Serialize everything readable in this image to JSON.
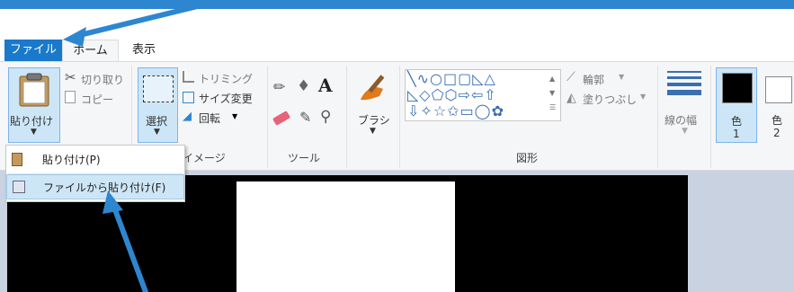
{
  "tabs": [
    {
      "label": "ファイル"
    },
    {
      "label": "ホーム"
    },
    {
      "label": "表示"
    }
  ],
  "clipboard": {
    "paste_label": "貼り付け",
    "cut_label": "切り取り",
    "copy_label": "コピー"
  },
  "image": {
    "select_label": "選択",
    "crop_label": "トリミング",
    "resize_label": "サイズ変更",
    "rotate_label": "回転",
    "group_label": "イメージ"
  },
  "tools": {
    "group_label": "ツール",
    "text_tool_label": "A"
  },
  "brush": {
    "label": "ブラシ"
  },
  "shapes": {
    "outline_label": "輪郭",
    "fill_label": "塗りつぶし",
    "group_label": "図形"
  },
  "size": {
    "label": "線の幅"
  },
  "colors": {
    "color1_label": "色",
    "color1_num": "1",
    "color2_label": "色",
    "color2_num": "2",
    "color1_value": "#000000",
    "color2_value": "#ffffff"
  },
  "paste_menu": {
    "items": [
      {
        "label": "貼り付け(P)"
      },
      {
        "label": "ファイルから貼り付け(F)"
      }
    ]
  },
  "accent": "#1979ca",
  "arrow_color": "#2e86d0"
}
